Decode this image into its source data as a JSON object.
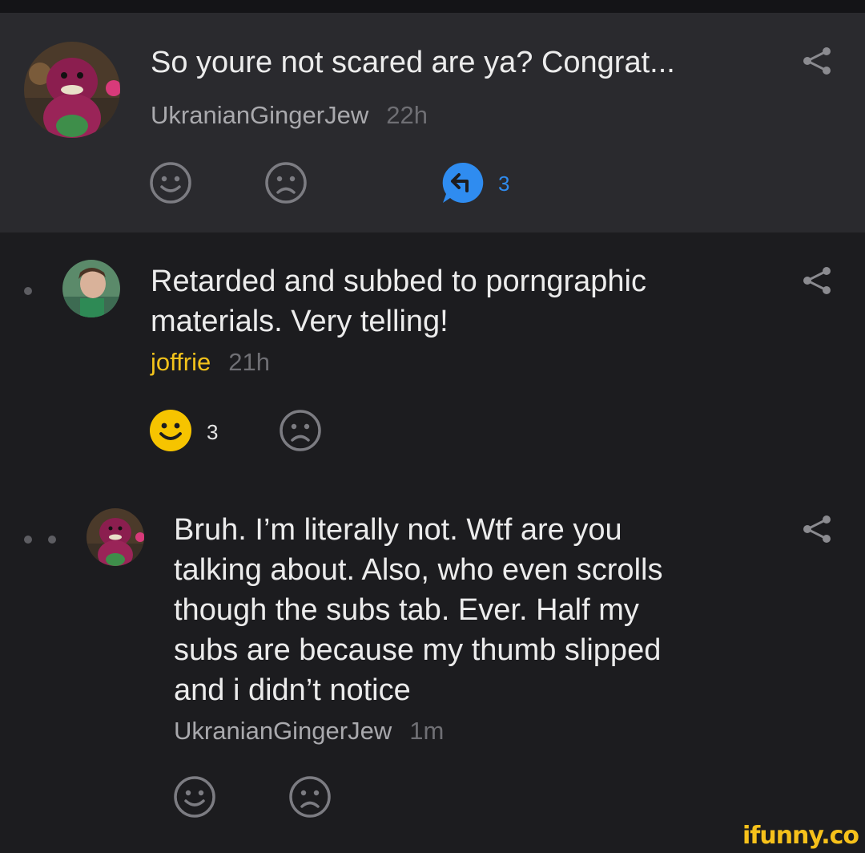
{
  "comments": [
    {
      "text": "So youre not scared are ya? Congrat...",
      "author": "UkranianGingerJew",
      "time": "22h",
      "replies_count": "3"
    },
    {
      "text_line1": "Retarded and subbed to porngraphic",
      "text_line2": "materials. Very telling!",
      "author": "joffrie",
      "time": "21h",
      "smile_count": "3"
    },
    {
      "text_lines": [
        "Bruh. I’m literally not. Wtf are you",
        "talking about. Also, who even scrolls",
        "though the subs tab. Ever. Half my",
        "subs are because my thumb slipped",
        "and i didn’t notice"
      ],
      "author": "UkranianGingerJew",
      "time": "1m"
    }
  ],
  "watermark": "ifunny.co",
  "colors": {
    "background": "#1c1c1f",
    "header_bg": "#2a2a2e",
    "accent_blue": "#2f8cf0",
    "smile_yellow": "#f6c400",
    "op_author": "#f2c21b"
  },
  "icons": [
    "share-icon",
    "smile-icon",
    "frown-icon",
    "reply-icon"
  ]
}
